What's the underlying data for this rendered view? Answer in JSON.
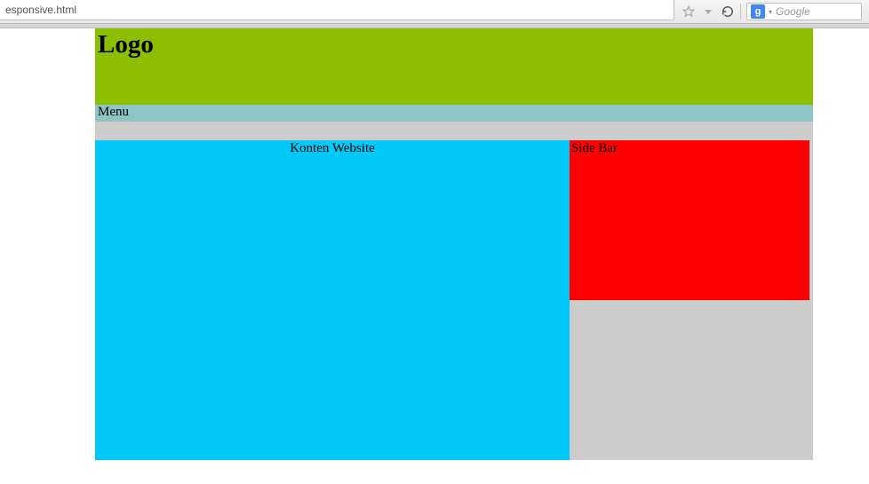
{
  "browser": {
    "url_fragment": "esponsive.html",
    "search_engine_badge": "g",
    "search_placeholder": "Google"
  },
  "page": {
    "header": {
      "logo": "Logo"
    },
    "menu": {
      "label": "Menu"
    },
    "main": {
      "title": "Konten Website"
    },
    "sidebar": {
      "title": "Side Bar"
    }
  },
  "colors": {
    "header_bg": "#8cbf00",
    "menu_bg": "#8fc4c4",
    "content_bg": "#00c8f8",
    "sidebar_bg": "#ff0000",
    "container_bg": "#cccccc"
  }
}
